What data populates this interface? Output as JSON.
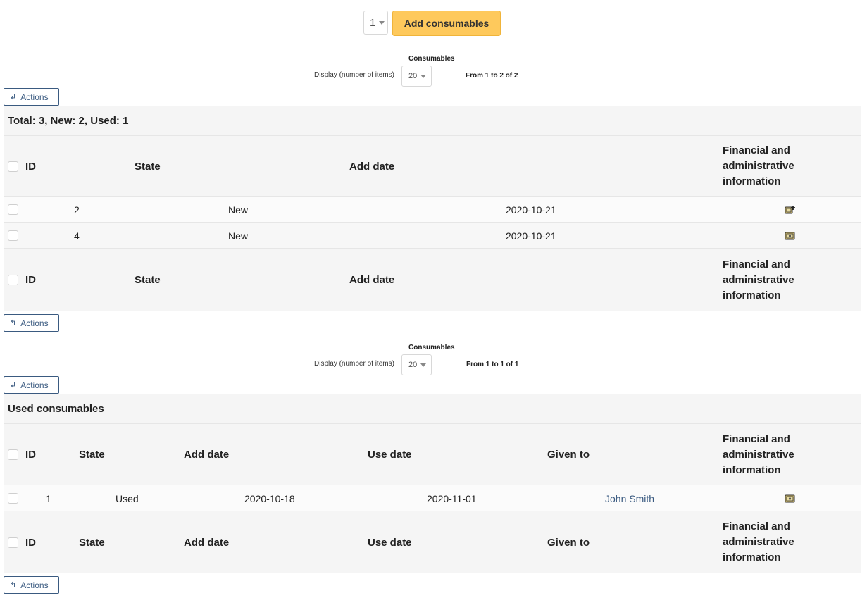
{
  "add_bar": {
    "quantity": "1",
    "add_label": "Add consumables"
  },
  "pager1": {
    "title": "Consumables",
    "display_label": "Display (number of items)",
    "per_page": "20",
    "count_text": "From 1 to 2 of 2"
  },
  "pager2": {
    "title": "Consumables",
    "display_label": "Display (number of items)",
    "per_page": "20",
    "count_text": "From 1 to 1 of 1"
  },
  "actions_label": "Actions",
  "table1": {
    "caption": "Total: 3, New: 2, Used: 1",
    "headers": {
      "id": "ID",
      "state": "State",
      "add_date": "Add date",
      "fin": "Financial and administrative information"
    },
    "rows": [
      {
        "id": "2",
        "state": "New",
        "add_date": "2020-10-21",
        "icon": "financial-add-icon"
      },
      {
        "id": "4",
        "state": "New",
        "add_date": "2020-10-21",
        "icon": "financial-info-icon"
      }
    ]
  },
  "table2": {
    "caption": "Used consumables",
    "headers": {
      "id": "ID",
      "state": "State",
      "add_date": "Add date",
      "use_date": "Use date",
      "given_to": "Given to",
      "fin": "Financial and administrative information"
    },
    "rows": [
      {
        "id": "1",
        "state": "Used",
        "add_date": "2020-10-18",
        "use_date": "2020-11-01",
        "given_to": "John Smith",
        "icon": "financial-info-icon"
      }
    ]
  },
  "colors": {
    "accent_button": "#fec95c",
    "link": "#3a5a80",
    "panel_bg": "#f5f5f5"
  }
}
